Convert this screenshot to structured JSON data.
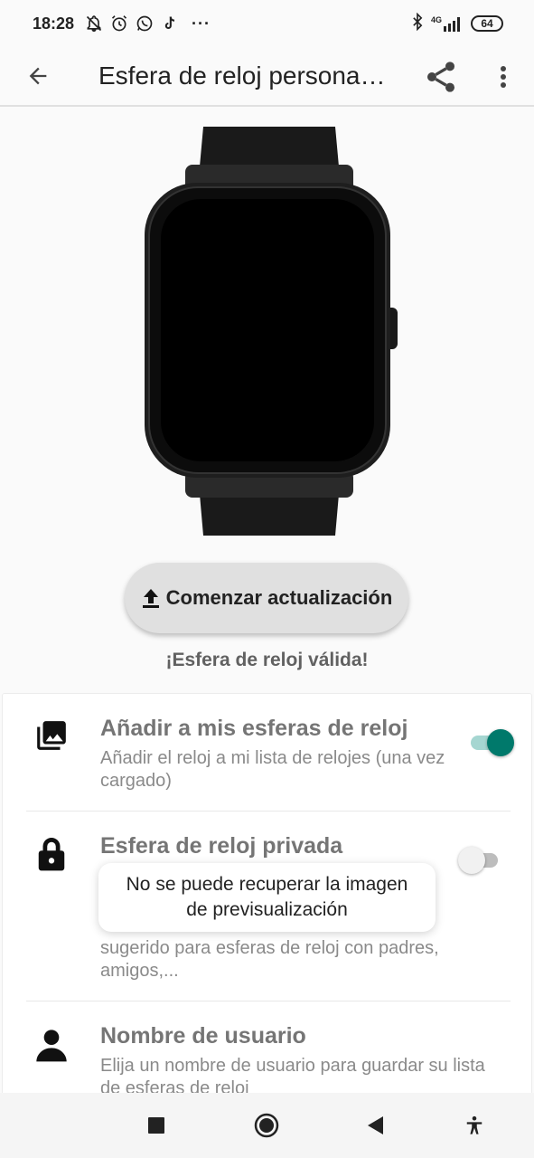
{
  "status_bar": {
    "time": "18:28",
    "more_dots": "···",
    "network": "4G",
    "battery": "64"
  },
  "app_bar": {
    "title": "Esfera de reloj personalizada"
  },
  "update_button": {
    "label": "Comenzar actualización"
  },
  "valid_text": "¡Esfera de reloj válida!",
  "settings": {
    "items": [
      {
        "icon": "photo-library-icon",
        "title": "Añadir a mis esferas de reloj",
        "description": "Añadir el reloj a mi lista de relojes (una vez cargado)",
        "toggle": true
      },
      {
        "icon": "lock-icon",
        "title": "Esfera de reloj privada",
        "description": "sugerido para esferas de reloj con padres, amigos,...",
        "toggle": false
      },
      {
        "icon": "person-icon",
        "title": "Nombre de usuario",
        "description": "Elija un nombre de usuario para guardar su lista de esferas de reloj"
      }
    ]
  },
  "toast": {
    "message": "No se puede recuperar la imagen de previsualización"
  },
  "colors": {
    "accent": "#00796b",
    "accent_track": "#a5d6d1",
    "button_bg": "#e0e0e0"
  }
}
